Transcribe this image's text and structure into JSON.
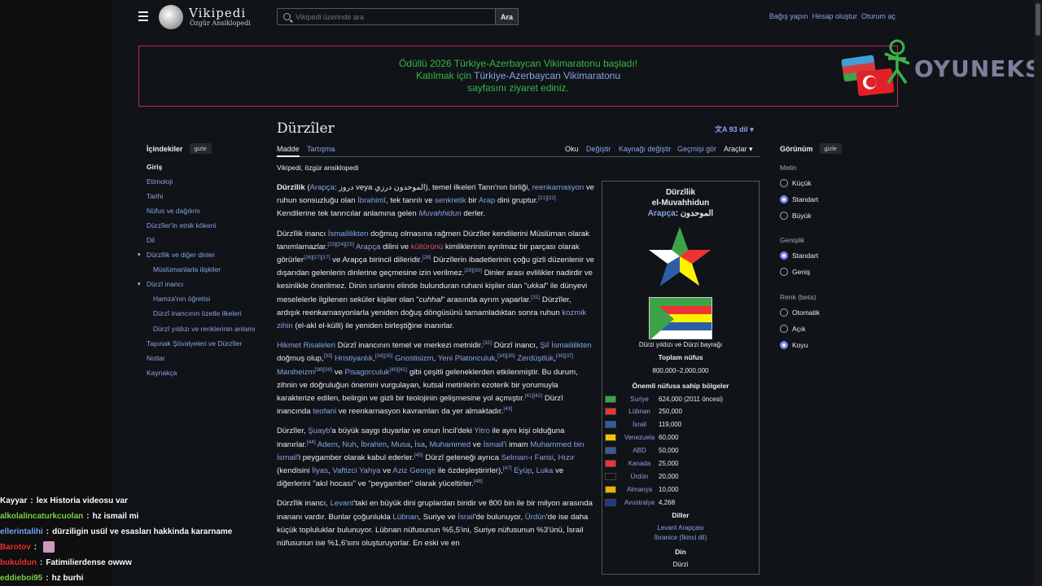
{
  "header": {
    "title": "Vikipedi",
    "tagline": "Özgür Ansiklopedi",
    "search_placeholder": "Vikipedi üzerinde ara",
    "search_button": "Ara",
    "links": [
      "Bağış yapın",
      "Hesap oluştur",
      "Oturum aç"
    ]
  },
  "banner": {
    "line1": "Ödüllü 2026 Türkiye-Azerbaycan Vikimaratonu başladı!",
    "line2_prefix": "Katılmak için",
    "line2_link": "Türkiye-Azerbaycan Vikimaratonu",
    "line3": "sayfasını ziyaret ediniz."
  },
  "brand": {
    "text": "OYUNEKS"
  },
  "toc": {
    "title": "İçindekiler",
    "hide": "gizle",
    "items": [
      "Giriş",
      "Etimoloji",
      "Tarihi",
      "Nüfus ve dağılımı",
      "Dürzîler'in etnik kökeni",
      "Dil",
      "Dürzîlik ve diğer dinler",
      "Müslümanlarla ilişkiler",
      "Dürzî inancı",
      "Hamza'nın öğretisi",
      "Dürzî inancının özetle ilkeleri",
      "Dürzî yıldızı ve renklerinin anlamı",
      "Tapınak Şövalyeleri ve Dürzîler",
      "Notlar",
      "Kaynakça"
    ]
  },
  "article": {
    "title": "Dürzîler",
    "languages": "93 dil",
    "tabs": {
      "article": "Madde",
      "talk": "Tartışma",
      "read": "Oku",
      "edit": "Değiştir",
      "edit_source": "Kaynağı değiştir",
      "history": "Geçmişi gör",
      "tools": "Araçlar"
    },
    "subtitle": "Vikipedi, özgür ansiklopedi"
  },
  "appearance": {
    "title": "Görünüm",
    "hide": "gizle",
    "text_label": "Metin",
    "text_options": [
      "Küçük",
      "Standart",
      "Büyük"
    ],
    "width_label": "Genişlik",
    "width_options": [
      "Standart",
      "Geniş"
    ],
    "color_label": "Renk (beta)",
    "color_options": [
      "Otomatik",
      "Açık",
      "Koyu"
    ]
  },
  "infobox": {
    "title1": "Dürzîlik",
    "title2": "el-Muvahhidun",
    "title3_link": "Arapça",
    "title3_text": ": الموحدون",
    "caption": "Dürzi yıldızı ve Dürzi bayrağı",
    "total_label": "Toplam nüfus",
    "total_value": "800,000–2,000,000",
    "regions_label": "Önemli nüfusa sahip bölgeler",
    "rows": [
      {
        "country": "Suriye",
        "value": "624,000 (2011 öncesi)",
        "c": "#3ea348"
      },
      {
        "country": "Lübnan",
        "value": "250,000",
        "c": "#e33"
      },
      {
        "country": "İsrail",
        "value": "119,000",
        "c": "#2c5ea8"
      },
      {
        "country": "Venezuela",
        "value": "60,000",
        "c": "#f5c400"
      },
      {
        "country": "ABD",
        "value": "50,000",
        "c": "#3c5a9a"
      },
      {
        "country": "Kanada",
        "value": "25,000",
        "c": "#e33"
      },
      {
        "country": "Ürdün",
        "value": "20,000",
        "c": "#111"
      },
      {
        "country": "Almanya",
        "value": "10,000",
        "c": "#e8b400"
      },
      {
        "country": "Avustralya",
        "value": "4,268",
        "c": "#1b3a8a"
      }
    ],
    "languages_label": "Diller",
    "languages_value1": "Levant Arapçası",
    "languages_value2": "İbranice (İkinci dil)",
    "religion_label": "Din",
    "religion_value": "Dürzi"
  },
  "chat": [
    {
      "user": "Kayyar",
      "color": "#ffffff",
      "msg": "lex Historia videosu var"
    },
    {
      "user": "alkolalincaturkcuolan",
      "color": "#7cd64a",
      "msg": "hz ismail mi"
    },
    {
      "user": "ellerintalihi",
      "color": "#6fa8ff",
      "msg": "dürziligin usül ve esasları hakkinda kararname"
    },
    {
      "user": "Barotov",
      "color": "#e33",
      "msg": ""
    },
    {
      "user": "bukuldun",
      "color": "#e33",
      "msg": "Fatimilierdense owww"
    },
    {
      "user": "eddieboi95",
      "color": "#7cd64a",
      "msg": "hz burhi"
    }
  ]
}
